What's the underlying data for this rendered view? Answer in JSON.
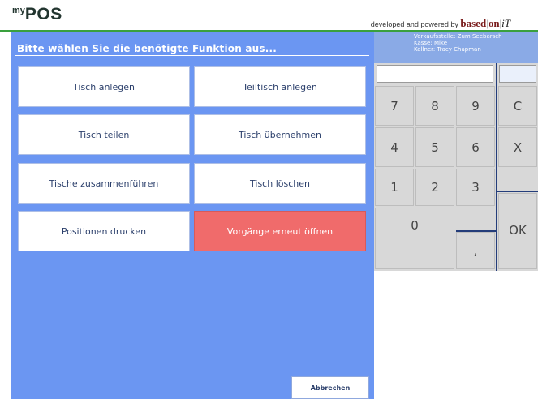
{
  "header": {
    "logo_prefix": "my",
    "logo_main": "POS",
    "credit_text": "developed and powered by",
    "brand_left": "based",
    "brand_sep": "|",
    "brand_mid": "on",
    "brand_right": "iT"
  },
  "colors": {
    "panel_blue": "#6b96f2",
    "info_blue": "#8aaae6",
    "accent_green": "#3aa03e",
    "highlight_red": "#f06b6b",
    "keypad_gray": "#d8d8d8"
  },
  "main": {
    "title": "Bitte wählen Sie die benötigte Funktion aus...",
    "buttons": [
      {
        "label": "Tisch anlegen"
      },
      {
        "label": "Teiltisch anlegen"
      },
      {
        "label": "Tisch teilen"
      },
      {
        "label": "Tisch übernehmen"
      },
      {
        "label": "Tische zusammenführen"
      },
      {
        "label": "Tisch löschen"
      },
      {
        "label": "Positionen drucken"
      },
      {
        "label": "Vorgänge erneut öffnen"
      }
    ],
    "cancel_label": "Abbrechen"
  },
  "info": {
    "line1": "Verkaufsstelle: Zum Seebarsch",
    "line2": "Kasse: Mike",
    "line3": "Kellner: Tracy Chapman"
  },
  "keypad": {
    "k7": "7",
    "k8": "8",
    "k9": "9",
    "clear": "C",
    "k4": "4",
    "k5": "5",
    "k6": "6",
    "multiply": "X",
    "k1": "1",
    "k2": "2",
    "k3": "3",
    "ok": "OK",
    "k0": "0",
    "comma": ","
  }
}
